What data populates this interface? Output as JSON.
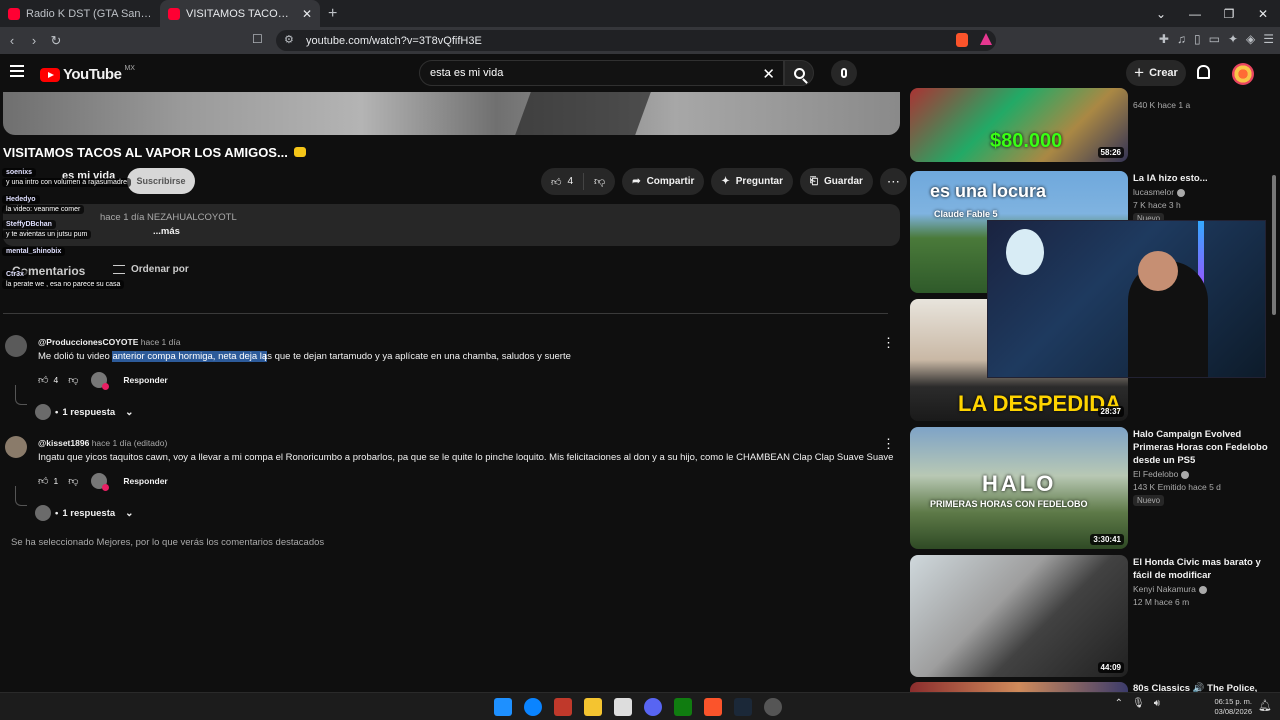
{
  "browser": {
    "tabs": [
      {
        "title": "Radio K DST (GTA San Andreas) (",
        "active": false
      },
      {
        "title": "VISITAMOS TACOS AL VAPOR LO",
        "active": true
      }
    ],
    "new_tab": "+",
    "url": "youtube.com/watch?v=3T8vQfifH3E"
  },
  "header": {
    "logo": "YouTube",
    "region": "MX",
    "search_value": "esta es mi vida",
    "create_label": "Crear"
  },
  "video": {
    "title": "VISITAMOS TACOS AL VAPOR LOS AMIGOS...",
    "channel": "es mi vida",
    "subscribe": "Suscribirse",
    "likes": "4",
    "share": "Compartir",
    "ask": "Preguntar",
    "save": "Guardar",
    "description_meta": "hace 1 día   NEZAHUALCOYOTL",
    "description_more": "...más"
  },
  "chat": [
    {
      "user": "soenixs",
      "msg": "y una intro con volumen a rajasumadre"
    },
    {
      "user": "Hededyo",
      "msg": "la video: veanme comer"
    },
    {
      "user": "SteffyDBchan",
      "msg": "y te avientas un jutsu pum"
    },
    {
      "user": "mental_shinobix",
      "msg": ""
    },
    {
      "user": "Ctr3x",
      "msg": "la perate we , esa no parece su casa"
    }
  ],
  "comments_section": {
    "heading": "Comentarios",
    "sort_label": "Ordenar por",
    "note": "Se ha seleccionado Mejores, por lo que verás los comentarios destacados"
  },
  "comments": [
    {
      "user": "@ProduccionesCOYOTE",
      "when": "hace 1 día",
      "text_before": "Me dolió tu video ",
      "text_highlight": "anterior compa hormiga, neta deja la",
      "text_after": "s que te dejan tartamudo y ya aplícate en una chamba, saludos y suerte",
      "likes": "4",
      "reply": "Responder",
      "replies": "1 respuesta"
    },
    {
      "user": "@kisset1896",
      "when": "hace 1 día (editado)",
      "text": "Ingatu que yicos taquitos cawn, voy a llevar a mi compa el Ronoricumbo a probarlos, pa que se le quite lo pinche loquito. Mis felicitaciones al don y a su hijo, como le CHAMBEAN Clap Clap Suave Suave",
      "likes": "1",
      "reply": "Responder",
      "replies": "1 respuesta"
    }
  ],
  "sidebar": [
    {
      "title": "",
      "channel": "",
      "meta": "640 K  hace 1 a",
      "duration": "58:26",
      "thumb_text": "$80.000"
    },
    {
      "title": "La IA hizo esto...",
      "channel": "lucasmelor",
      "meta": "7 K  hace 3 h",
      "badge": "Nuevo",
      "thumb_text": "es una locura",
      "thumb_sub": "Claude Fable 5"
    },
    {
      "title": "",
      "channel": "",
      "meta": "",
      "duration": "28:37",
      "thumb_text": "LA DESPEDIDA"
    },
    {
      "title": "Halo Campaign Evolved Primeras Horas con Fedelobo desde un PS5",
      "channel": "El Fedelobo",
      "meta": "143 K  Emitido hace 5 d",
      "badge": "Nuevo",
      "duration": "3:30:41",
      "thumb_text": "HALO",
      "thumb_sub": "PRIMERAS HORAS CON FEDELOBO"
    },
    {
      "title": "El Honda Civic mas barato y fácil de modificar",
      "channel": "Kenyi Nakamura",
      "meta": "12 M  hace 6 m",
      "duration": "44:09"
    },
    {
      "title": "80s Classics 🔊 The Police,",
      "channel": "",
      "meta": ""
    }
  ],
  "taskbar": {
    "time": "06:15 p. m.",
    "date": "03/08/2026"
  },
  "colors": {
    "bg": "#0f0f0f",
    "highlight": "#2d5b9a",
    "brand_red": "#ff0000"
  }
}
